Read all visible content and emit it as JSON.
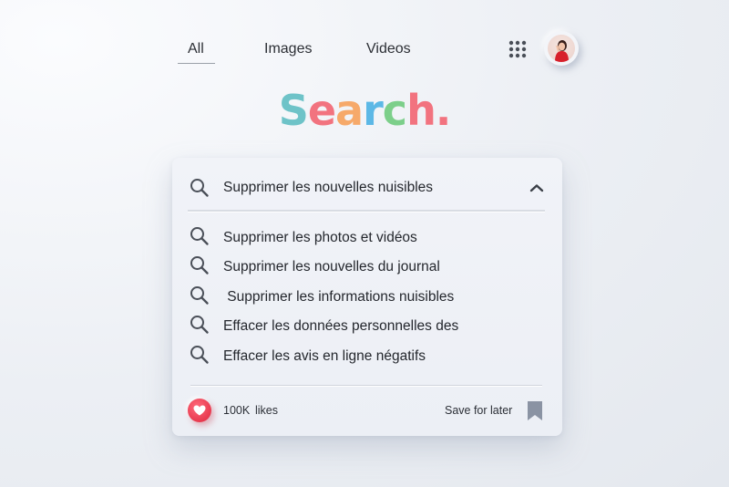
{
  "nav": {
    "tabs": [
      {
        "label": "All",
        "active": true
      },
      {
        "label": "Images",
        "active": false
      },
      {
        "label": "Videos",
        "active": false
      }
    ],
    "apps_icon": "grid-apps-icon",
    "avatar_icon": "user-avatar"
  },
  "logo": {
    "letters": [
      {
        "char": "S",
        "color": "#6ec3c8"
      },
      {
        "char": "e",
        "color": "#f2737f"
      },
      {
        "char": "a",
        "color": "#f6a96a"
      },
      {
        "char": "r",
        "color": "#5cb8e6"
      },
      {
        "char": "c",
        "color": "#7ccf8a"
      },
      {
        "char": "h",
        "color": "#f2737f"
      },
      {
        "char": ".",
        "color": "#f2737f"
      }
    ]
  },
  "search": {
    "query": "Supprimer les nouvelles nuisibles",
    "suggestions": [
      "Supprimer les photos et vidéos",
      "Supprimer les nouvelles du journal",
      " Supprimer les informations nuisibles",
      "Effacer les données personnelles des",
      "Effacer les avis en ligne négatifs"
    ]
  },
  "footer": {
    "likes_count": "100K",
    "likes_label": "likes",
    "save_label": "Save for later"
  },
  "colors": {
    "accent_red": "#e83a4f",
    "icon_gray": "#4a4f58",
    "bookmark_gray": "#8a93a3"
  }
}
